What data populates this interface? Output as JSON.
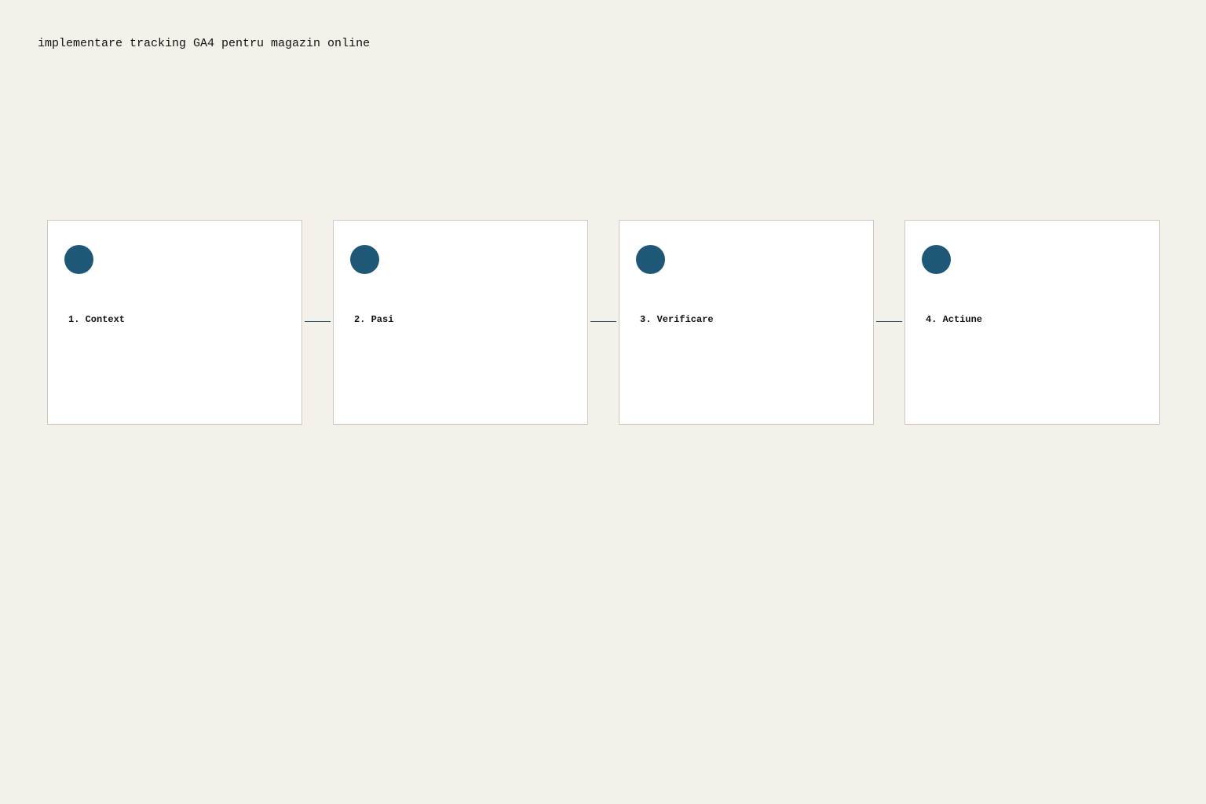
{
  "title": "implementare tracking GA4 pentru magazin online",
  "colors": {
    "background": "#f4f1ea",
    "card": "#ffffff",
    "card_border": "#cfc8be",
    "accent": "#1f5876"
  },
  "steps": [
    {
      "label": "1. Context"
    },
    {
      "label": "2. Pasi"
    },
    {
      "label": "3. Verificare"
    },
    {
      "label": "4. Actiune"
    }
  ]
}
